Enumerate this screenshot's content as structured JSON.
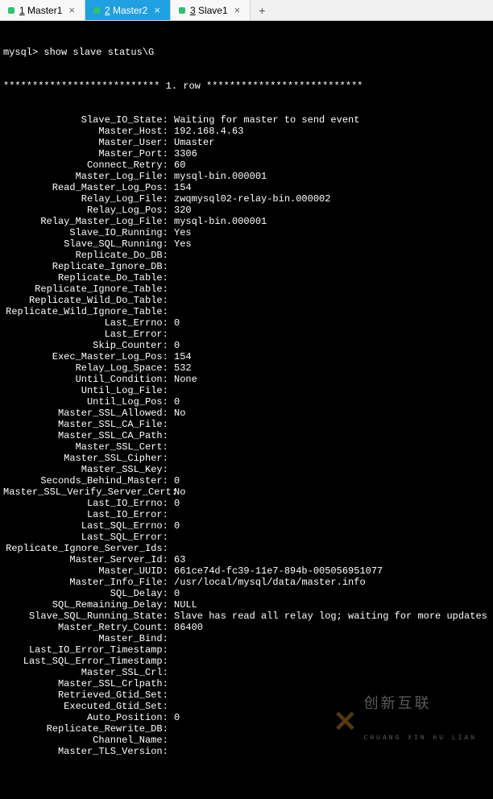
{
  "tabs": {
    "items": [
      {
        "num": "1",
        "name": "Master1",
        "active": false
      },
      {
        "num": "2",
        "name": "Master2",
        "active": true
      },
      {
        "num": "3",
        "name": "Slave1",
        "active": false
      }
    ],
    "close_glyph": "×",
    "add_glyph": "+"
  },
  "terminal": {
    "prompt": "mysql> show slave status\\G",
    "row_header": "*************************** 1. row ***************************",
    "fields": [
      {
        "key": "Slave_IO_State",
        "val": "Waiting for master to send event"
      },
      {
        "key": "Master_Host",
        "val": "192.168.4.63"
      },
      {
        "key": "Master_User",
        "val": "Umaster"
      },
      {
        "key": "Master_Port",
        "val": "3306"
      },
      {
        "key": "Connect_Retry",
        "val": "60"
      },
      {
        "key": "Master_Log_File",
        "val": "mysql-bin.000001"
      },
      {
        "key": "Read_Master_Log_Pos",
        "val": "154"
      },
      {
        "key": "Relay_Log_File",
        "val": "zwqmysql02-relay-bin.000002"
      },
      {
        "key": "Relay_Log_Pos",
        "val": "320"
      },
      {
        "key": "Relay_Master_Log_File",
        "val": "mysql-bin.000001"
      },
      {
        "key": "Slave_IO_Running",
        "val": "Yes"
      },
      {
        "key": "Slave_SQL_Running",
        "val": "Yes"
      },
      {
        "key": "Replicate_Do_DB",
        "val": ""
      },
      {
        "key": "Replicate_Ignore_DB",
        "val": ""
      },
      {
        "key": "Replicate_Do_Table",
        "val": ""
      },
      {
        "key": "Replicate_Ignore_Table",
        "val": ""
      },
      {
        "key": "Replicate_Wild_Do_Table",
        "val": ""
      },
      {
        "key": "Replicate_Wild_Ignore_Table",
        "val": ""
      },
      {
        "key": "Last_Errno",
        "val": "0"
      },
      {
        "key": "Last_Error",
        "val": ""
      },
      {
        "key": "Skip_Counter",
        "val": "0"
      },
      {
        "key": "Exec_Master_Log_Pos",
        "val": "154"
      },
      {
        "key": "Relay_Log_Space",
        "val": "532"
      },
      {
        "key": "Until_Condition",
        "val": "None"
      },
      {
        "key": "Until_Log_File",
        "val": ""
      },
      {
        "key": "Until_Log_Pos",
        "val": "0"
      },
      {
        "key": "Master_SSL_Allowed",
        "val": "No"
      },
      {
        "key": "Master_SSL_CA_File",
        "val": ""
      },
      {
        "key": "Master_SSL_CA_Path",
        "val": ""
      },
      {
        "key": "Master_SSL_Cert",
        "val": ""
      },
      {
        "key": "Master_SSL_Cipher",
        "val": ""
      },
      {
        "key": "Master_SSL_Key",
        "val": ""
      },
      {
        "key": "Seconds_Behind_Master",
        "val": "0"
      },
      {
        "key": "Master_SSL_Verify_Server_Cert",
        "val": "No"
      },
      {
        "key": "Last_IO_Errno",
        "val": "0"
      },
      {
        "key": "Last_IO_Error",
        "val": ""
      },
      {
        "key": "Last_SQL_Errno",
        "val": "0"
      },
      {
        "key": "Last_SQL_Error",
        "val": ""
      },
      {
        "key": "Replicate_Ignore_Server_Ids",
        "val": ""
      },
      {
        "key": "Master_Server_Id",
        "val": "63"
      },
      {
        "key": "Master_UUID",
        "val": "661ce74d-fc39-11e7-894b-005056951077"
      },
      {
        "key": "Master_Info_File",
        "val": "/usr/local/mysql/data/master.info"
      },
      {
        "key": "SQL_Delay",
        "val": "0"
      },
      {
        "key": "SQL_Remaining_Delay",
        "val": "NULL"
      },
      {
        "key": "Slave_SQL_Running_State",
        "val": "Slave has read all relay log; waiting for more updates"
      },
      {
        "key": "Master_Retry_Count",
        "val": "86400"
      },
      {
        "key": "Master_Bind",
        "val": ""
      },
      {
        "key": "Last_IO_Error_Timestamp",
        "val": ""
      },
      {
        "key": "Last_SQL_Error_Timestamp",
        "val": ""
      },
      {
        "key": "Master_SSL_Crl",
        "val": ""
      },
      {
        "key": "Master_SSL_Crlpath",
        "val": ""
      },
      {
        "key": "Retrieved_Gtid_Set",
        "val": ""
      },
      {
        "key": "Executed_Gtid_Set",
        "val": ""
      },
      {
        "key": "Auto_Position",
        "val": "0"
      },
      {
        "key": "Replicate_Rewrite_DB",
        "val": ""
      },
      {
        "key": "Channel_Name",
        "val": ""
      },
      {
        "key": "Master_TLS_Version",
        "val": ""
      }
    ]
  },
  "watermark": {
    "top": "创新互联",
    "bot": "CHUANG XIN HU LIAN"
  }
}
